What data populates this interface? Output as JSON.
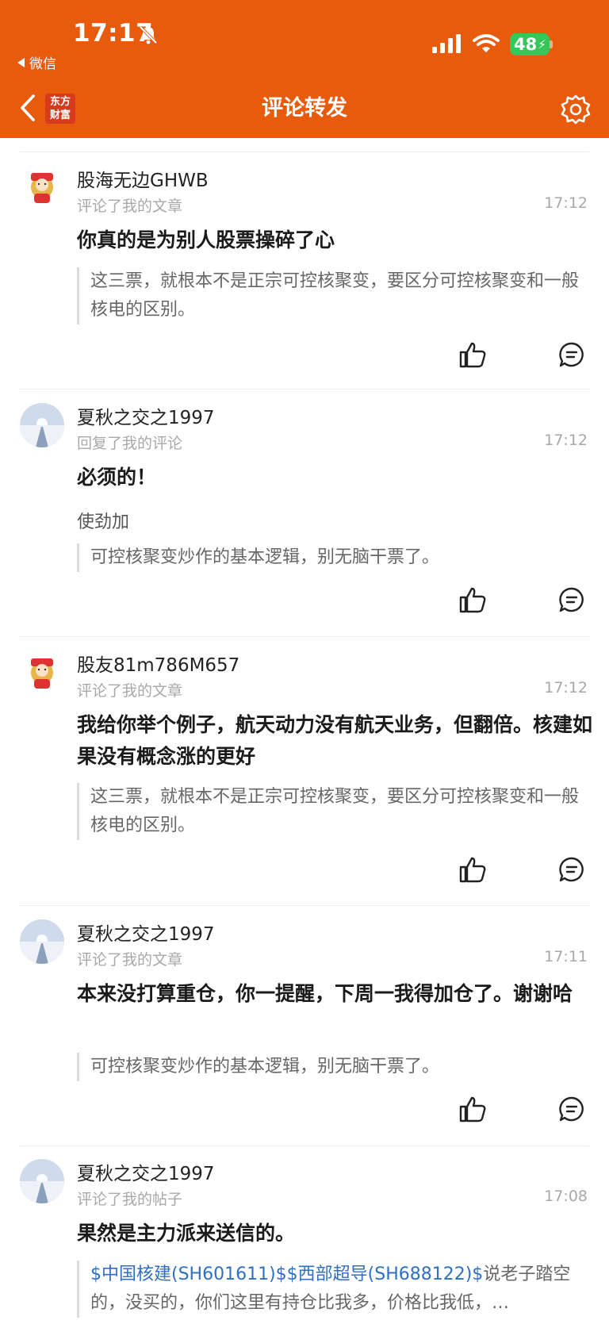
{
  "status": {
    "time": "17:17",
    "back_app": "微信",
    "battery": "48"
  },
  "nav": {
    "logo_line1": "东方",
    "logo_line2": "财富",
    "title": "评论转发"
  },
  "items": [
    {
      "user": "股海无边GHWB",
      "action": "评论了我的文章",
      "time": "17:12",
      "comment": "你真的是为别人股票操碎了心",
      "reply": "",
      "quote": "这三票，就根本不是正宗可控核聚变，要区分可控核聚变和一般核电的区别。"
    },
    {
      "user": "夏秋之交之1997",
      "action": "回复了我的评论",
      "time": "17:12",
      "comment": "必须的！",
      "reply": "使劲加",
      "quote": "可控核聚变炒作的基本逻辑，别无脑干票了。"
    },
    {
      "user": "股友81m786M657",
      "action": "评论了我的文章",
      "time": "17:12",
      "comment": "我给你举个例子，航天动力没有航天业务，但翻倍。核建如果没有概念涨的更好",
      "reply": "",
      "quote": "这三票，就根本不是正宗可控核聚变，要区分可控核聚变和一般核电的区别。"
    },
    {
      "user": "夏秋之交之1997",
      "action": "评论了我的文章",
      "time": "17:11",
      "comment": "本来没打算重仓，你一提醒，下周一我得加仓了。谢谢哈",
      "reply": "",
      "quote": "可控核聚变炒作的基本逻辑，别无脑干票了。"
    },
    {
      "user": "夏秋之交之1997",
      "action": "评论了我的帖子",
      "time": "17:08",
      "comment": "果然是主力派来送信的。",
      "reply": "",
      "quote_link": "$中国核建(SH601611)$$西部超导(SH688122)$",
      "quote": "说老子踏空的，没买的，你们这里有持仓比我多，价格比我低，…"
    }
  ],
  "colors": {
    "header": "#e85a0c",
    "link": "#2f6fc4",
    "battery": "#35c759"
  }
}
